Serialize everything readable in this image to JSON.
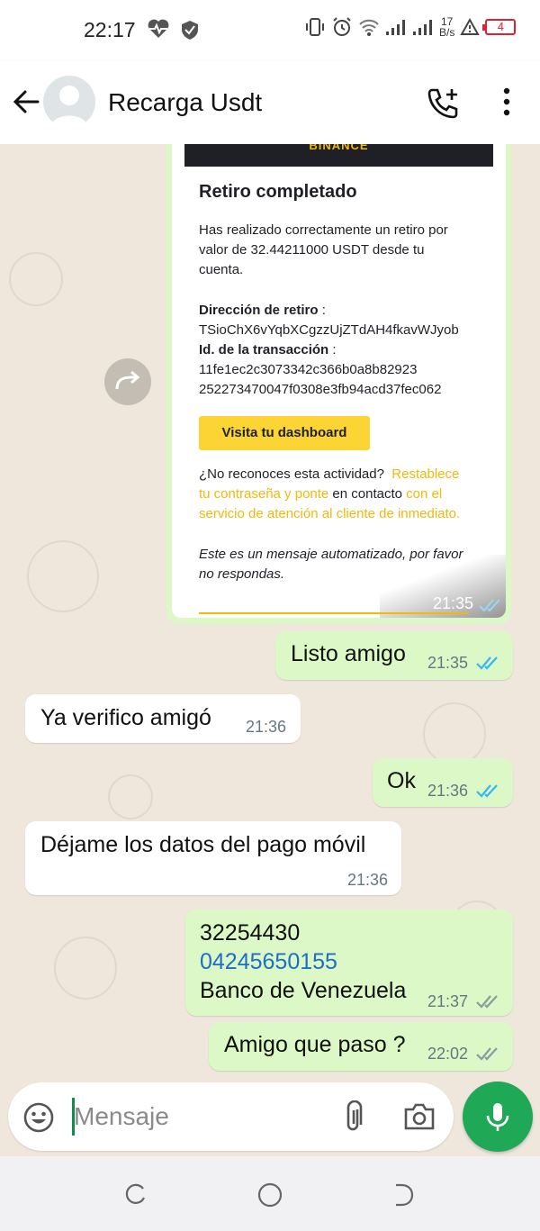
{
  "status_bar": {
    "time": "22:17",
    "net_speed_value": "17",
    "net_speed_unit": "B/s",
    "battery": "4",
    "icons": [
      "heart-pulse-icon",
      "shield-icon",
      "vibrate-icon",
      "alarm-icon",
      "wifi-icon",
      "signal-icon",
      "signal-icon",
      "warning-icon",
      "battery-icon"
    ]
  },
  "header": {
    "contact_name": "Recarga Usdt",
    "icons": [
      "back-arrow-icon",
      "avatar",
      "add-call-icon",
      "more-vert-icon"
    ]
  },
  "image_message": {
    "card": {
      "brand": "BINANCE",
      "title": "Retiro completado",
      "intro_line1": "Has realizado correctamente un retiro por",
      "intro_line2": "valor de 32.44211000 USDT desde tu",
      "intro_line3": "cuenta.",
      "address_label": "Dirección de retiro",
      "address_sep": " :",
      "address": "TSioChX6vYqbXCgzzUjZTdAH4fkavWJyob",
      "txid_label": "Id. de la transacción",
      "txid_sep": " :",
      "txid_line1": "11fe1ec2c3073342c366b0a8b82923",
      "txid_line2": "252273470047f0308e3fb94acd37fec062",
      "button": "Visita tu dashboard",
      "warn_q": "¿No reconoces esta actividad?",
      "warn_link1": "Restablece",
      "warn_link2": "tu contraseña y ponte",
      "warn_mid": " en contacto ",
      "warn_link3": "con el",
      "warn_link4": "servicio de atención al cliente de inmediato.",
      "auto_line1": "Este es un mensaje automatizado, por favor",
      "auto_line2": "no respondas."
    },
    "time": "21:35",
    "status": "read"
  },
  "messages": [
    {
      "dir": "out",
      "text": "Listo amigo",
      "time": "21:35",
      "status": "read"
    },
    {
      "dir": "in",
      "text": "Ya verifico amigó",
      "time": "21:36"
    },
    {
      "dir": "out",
      "text": "Ok",
      "time": "21:36",
      "status": "read"
    },
    {
      "dir": "in",
      "text": "Déjame los datos del pago móvil",
      "time": "21:36"
    },
    {
      "dir": "out",
      "lines": [
        "32254430",
        "04245650155",
        "Banco de Venezuela"
      ],
      "time": "21:37",
      "status": "delivered"
    },
    {
      "dir": "out",
      "text": "Amigo que paso ?",
      "time": "22:02",
      "status": "delivered"
    }
  ],
  "input": {
    "placeholder": "Mensaje",
    "icons": [
      "emoji-icon",
      "attach-icon",
      "camera-icon",
      "mic-icon"
    ]
  },
  "nav": {
    "icons": [
      "recent-apps-icon",
      "home-icon",
      "back-icon"
    ]
  },
  "colors": {
    "outgoing_bubble": "#dcf8c6",
    "incoming_bubble": "#ffffff",
    "chat_background": "#efe7dc",
    "read_ticks": "#34b7f1",
    "phone_link": "#1b6fc9",
    "accent_green": "#1fa855",
    "binance_yellow": "#fcd535"
  }
}
